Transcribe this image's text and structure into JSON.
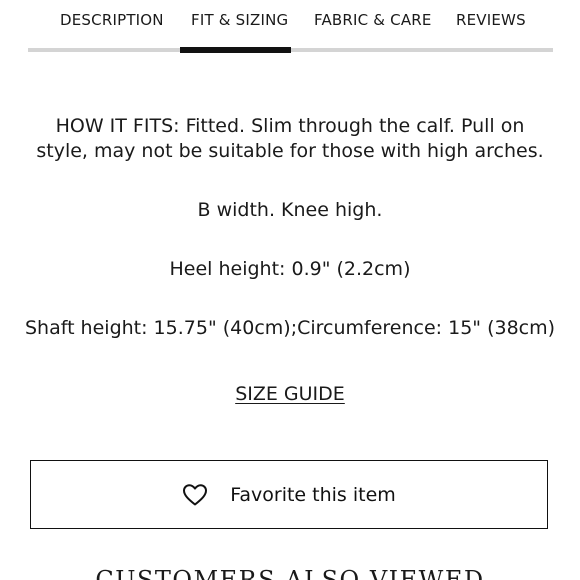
{
  "tabs": [
    {
      "label": "DESCRIPTION"
    },
    {
      "label": "FIT & SIZING",
      "active": true
    },
    {
      "label": "FABRIC & CARE"
    },
    {
      "label": "REVIEWS"
    }
  ],
  "fit": {
    "how_it_fits_line1": "HOW IT FITS: Fitted. Slim through the calf. Pull on",
    "how_it_fits_line2": "style, may not be suitable for those with high arches.",
    "width": "B width. Knee high.",
    "heel": "Heel height: 0.9\" (2.2cm)",
    "shaft": "Shaft height: 15.75\" (40cm);Circumference: 15\" (38cm)"
  },
  "size_guide_label": "SIZE GUIDE",
  "favorite": {
    "label": "Favorite this item",
    "icon": "heart-outline-icon"
  },
  "customers_also_viewed": "CUSTOMERS ALSO VIEWED",
  "colors": {
    "text": "#1a1a1a",
    "active_tab_indicator": "#111111",
    "tab_track": "#d4d4d4",
    "background": "#ffffff"
  }
}
